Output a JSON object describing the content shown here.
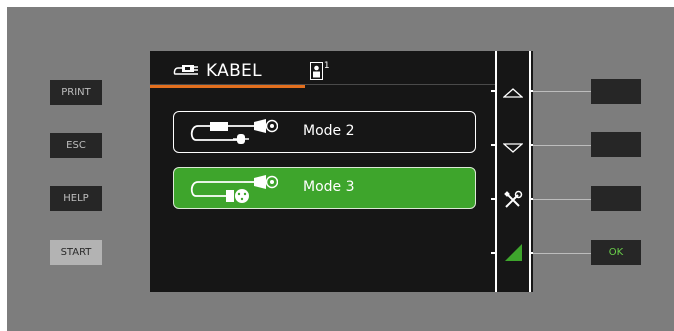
{
  "left_buttons": {
    "print": "PRINT",
    "esc": "ESC",
    "help": "HELP",
    "start": "START"
  },
  "screen": {
    "title": "KABEL",
    "title_icon": "cable-plug-icon",
    "badge_icon": "person-1-icon",
    "badge_superscript": "1",
    "modes": [
      {
        "label": "Mode 2",
        "icon": "cable-mode2-icon",
        "selected": false
      },
      {
        "label": "Mode 3",
        "icon": "cable-mode3-icon",
        "selected": true
      }
    ]
  },
  "softkeys": {
    "up": "triangle-up-icon",
    "down": "triangle-down-icon",
    "tools": "tools-icon",
    "ok_indicator": "green-ramp-icon"
  },
  "right_buttons": {
    "ok": "OK"
  },
  "colors": {
    "accent_orange": "#e36f1e",
    "selected_green": "#3ea52c",
    "ok_text": "#6ad04a"
  }
}
